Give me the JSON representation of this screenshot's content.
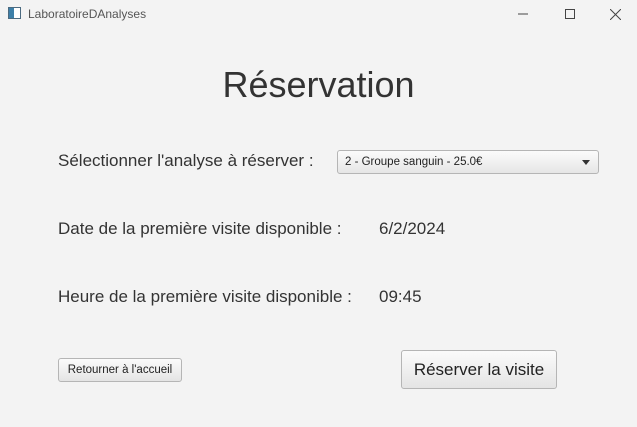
{
  "window": {
    "title": "LaboratoireDAnalyses",
    "icon": "java-app-icon",
    "controls": [
      "minimize-icon",
      "maximize-icon",
      "close-icon"
    ]
  },
  "page": {
    "heading": "Réservation"
  },
  "form": {
    "select_label": "Sélectionner l'analyse à réserver :",
    "selected_analysis": "2 - Groupe sanguin - 25.0€",
    "date_label": "Date de la première visite disponible :",
    "date_value": "6/2/2024",
    "time_label": "Heure de la première visite disponible :",
    "time_value": "09:45"
  },
  "actions": {
    "back_label": "Retourner à l'accueil",
    "reserve_label": "Réserver la visite"
  }
}
